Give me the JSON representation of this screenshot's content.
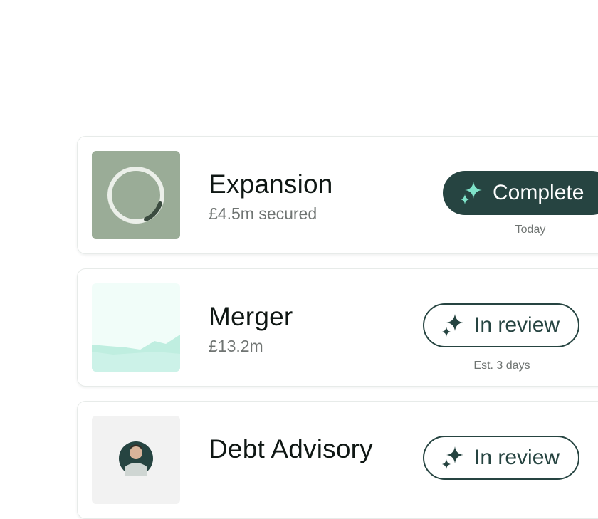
{
  "cards": [
    {
      "title": "Expansion",
      "subtitle": "£4.5m secured",
      "status": "Complete",
      "note": "Today",
      "status_style": "filled",
      "thumbnail": "progress-ring"
    },
    {
      "title": "Merger",
      "subtitle": "£13.2m",
      "status": "In review",
      "note": "Est. 3 days",
      "status_style": "outline",
      "thumbnail": "area-chart"
    },
    {
      "title": "Debt Advisory",
      "subtitle": "",
      "status": "In review",
      "note": "",
      "status_style": "outline",
      "thumbnail": "avatar"
    }
  ],
  "colors": {
    "primary": "#264441",
    "sparkle_accent": "#7fe3c9",
    "thumb_green": "#9aac97",
    "ring": "#ebefe9",
    "ring_dark": "#3b4c40",
    "area_fill": "#bfeee0"
  }
}
